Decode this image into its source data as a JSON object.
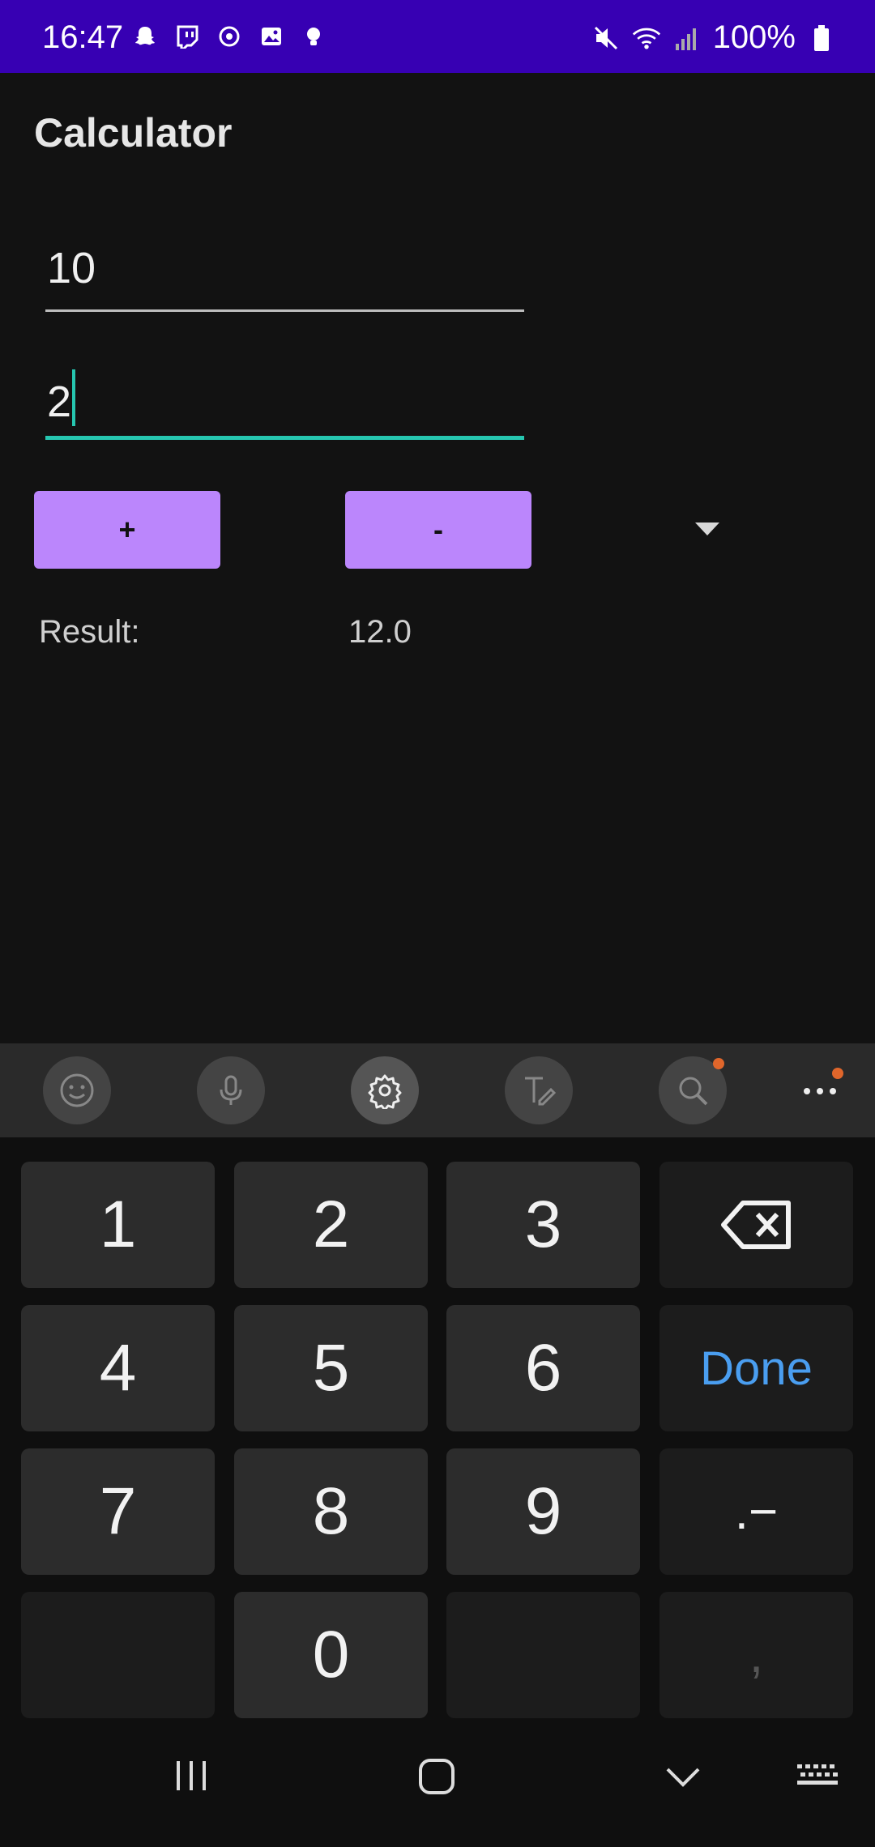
{
  "status_bar": {
    "time": "16:47",
    "battery": "100%",
    "left_icons": [
      "snapchat-icon",
      "twitch-icon",
      "sync-icon",
      "gallery-icon",
      "bulb-icon"
    ],
    "right_icons": [
      "mute-icon",
      "wifi-icon",
      "signal-icon",
      "battery-icon"
    ]
  },
  "app": {
    "title": "Calculator",
    "input1": "10",
    "input2": "2",
    "plus_label": "+",
    "minus_label": "-",
    "result_label": "Result:",
    "result_value": "12.0"
  },
  "colors": {
    "status_bar": "#3700b3",
    "button": "#bb86fc",
    "focus": "#26c6b0",
    "done": "#4a9ef0"
  },
  "keyboard": {
    "toolbar": [
      "emoji-icon",
      "mic-icon",
      "settings-icon",
      "handwriting-icon",
      "search-icon",
      "more-icon"
    ],
    "keys": {
      "k1": "1",
      "k2": "2",
      "k3": "3",
      "k4": "4",
      "k5": "5",
      "k6": "6",
      "k7": "7",
      "k8": "8",
      "k9": "9",
      "k0": "0",
      "done": "Done",
      "dot_minus": ".−",
      "comma": ","
    }
  },
  "nav": [
    "recents-icon",
    "home-icon",
    "hide-keyboard-icon",
    "keyboard-switch-icon"
  ]
}
